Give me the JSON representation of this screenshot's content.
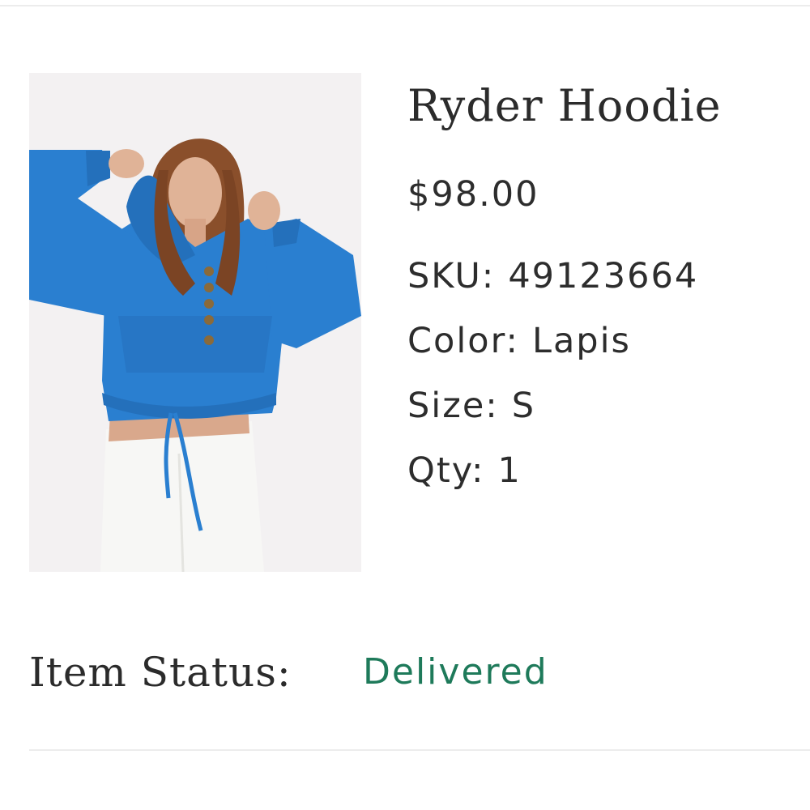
{
  "product": {
    "name": "Ryder Hoodie",
    "price": "$98.00",
    "sku_label": "SKU:",
    "sku_value": "49123664",
    "color_label": "Color:",
    "color_value": "Lapis",
    "size_label": "Size:",
    "size_value": "S",
    "qty_label": "Qty:",
    "qty_value": "1",
    "image_icon": "product-photo"
  },
  "status": {
    "label": "Item Status:",
    "value": "Delivered",
    "value_color": "#1e7a5a"
  },
  "colors": {
    "hoodie": "#2a7fd0",
    "background": "#ffffff",
    "text": "#2d2d2d"
  }
}
